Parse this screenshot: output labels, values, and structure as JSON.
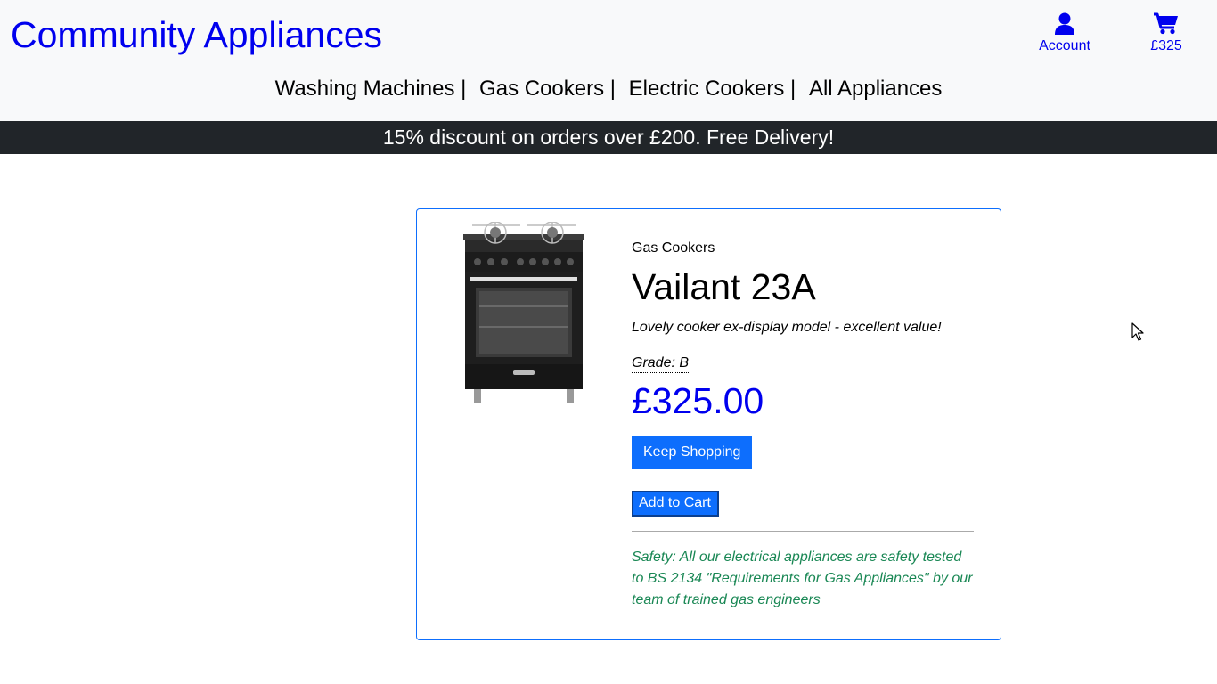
{
  "header": {
    "brand": "Community Appliances",
    "account_label": "Account",
    "cart_total": "£325"
  },
  "nav": {
    "items": [
      {
        "label": "Washing Machines |"
      },
      {
        "label": "Gas Cookers |"
      },
      {
        "label": "Electric Cookers |"
      },
      {
        "label": "All Appliances"
      }
    ]
  },
  "banner": {
    "text": "15% discount on orders over £200. Free Delivery!"
  },
  "product": {
    "category": "Gas Cookers",
    "name": "Vailant 23A",
    "description": "Lovely cooker ex-display model - excellent value!",
    "grade": "Grade: B",
    "price": "£325.00",
    "keep_shopping_label": "Keep Shopping",
    "add_to_cart_label": "Add to Cart",
    "safety_note": "Safety: All our electrical appliances are safety tested to BS 2134 \"Requirements for Gas Appliances\" by our team of trained gas engineers"
  },
  "icons": {
    "account": "person-icon",
    "cart": "shopping-cart-icon"
  },
  "colors": {
    "link": "#0000ee",
    "header_bg": "#f8f9fa",
    "banner_bg": "#212529",
    "primary_button": "#0d6efd",
    "safety_text": "#198754"
  }
}
